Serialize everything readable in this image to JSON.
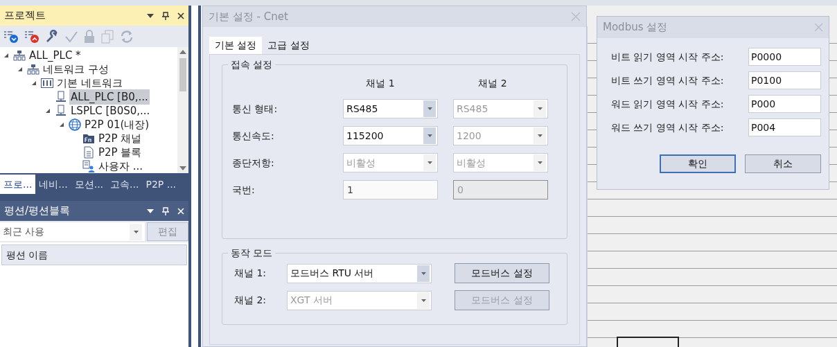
{
  "project_panel": {
    "title": "프로젝트",
    "tree": [
      {
        "label": "ALL_PLC *",
        "kind": "network",
        "expanded": true,
        "selected": false,
        "children": [
          {
            "label": "네트워크 구성",
            "kind": "network",
            "expanded": true,
            "selected": false,
            "children": [
              {
                "label": "기본 네트워크",
                "kind": "rack",
                "expanded": true,
                "selected": false,
                "children": [
                  {
                    "label": "ALL_PLC [B0,...",
                    "kind": "plc",
                    "expanded": false,
                    "selected": true
                  },
                  {
                    "label": "LSPLC [B0S0,...",
                    "kind": "plc",
                    "expanded": true,
                    "selected": false,
                    "children": [
                      {
                        "label": "P2P 01(내장)",
                        "kind": "globe",
                        "expanded": true,
                        "selected": false,
                        "children": [
                          {
                            "label": "P2P 채널",
                            "kind": "fn",
                            "expanded": false,
                            "selected": false
                          },
                          {
                            "label": "P2P 블록",
                            "kind": "doc",
                            "expanded": false,
                            "selected": false
                          },
                          {
                            "label": "사용자 ...",
                            "kind": "user",
                            "expanded": false,
                            "selected": false
                          }
                        ]
                      }
                    ]
                  }
                ]
              }
            ]
          }
        ]
      }
    ]
  },
  "bottom_tabs": [
    {
      "label": "프로...",
      "selected": true
    },
    {
      "label": "네비...",
      "selected": false
    },
    {
      "label": "모션...",
      "selected": false
    },
    {
      "label": "고속...",
      "selected": false
    },
    {
      "label": "P2P ...",
      "selected": false
    }
  ],
  "function_panel": {
    "title": "평션/평션블록",
    "filter": {
      "value": "최근 사용"
    },
    "edit_button": "편집",
    "column": "평션 이름"
  },
  "cnet_dialog": {
    "title": "기본 설정 - Cnet",
    "tabs": [
      {
        "label": "기본 설정",
        "selected": true
      },
      {
        "label": "고급 설정",
        "selected": false
      }
    ],
    "connection": {
      "title": "접속 설정",
      "columns": [
        "채널 1",
        "채널 2"
      ],
      "rows": [
        {
          "label": "통신 형태:",
          "cells": [
            {
              "kind": "combo",
              "value": "RS485",
              "disabled": false
            },
            {
              "kind": "combo",
              "value": "RS485",
              "disabled": true
            }
          ]
        },
        {
          "label": "통신속도:",
          "cells": [
            {
              "kind": "combo",
              "value": "115200",
              "disabled": false
            },
            {
              "kind": "combo",
              "value": "1200",
              "disabled": true
            }
          ]
        },
        {
          "label": "종단저항:",
          "cells": [
            {
              "kind": "combo",
              "value": "비활성",
              "disabled": true
            },
            {
              "kind": "combo",
              "value": "비활성",
              "disabled": true
            }
          ]
        },
        {
          "label": "국번:",
          "cells": [
            {
              "kind": "field",
              "value": "1",
              "disabled": false
            },
            {
              "kind": "field",
              "value": "0",
              "disabled": true
            }
          ]
        }
      ]
    },
    "mode": {
      "title": "동작 모드",
      "rows": [
        {
          "label": "채널 1:",
          "combo": {
            "value": "모드버스 RTU 서버",
            "disabled": false
          },
          "button": {
            "label": "모드버스 설정",
            "disabled": false
          }
        },
        {
          "label": "채널 2:",
          "combo": {
            "value": "XGT 서버",
            "disabled": true
          },
          "button": {
            "label": "모드버스 설정",
            "disabled": true
          }
        }
      ]
    }
  },
  "modbus_dialog": {
    "title": "Modbus 설정",
    "fields": [
      {
        "label": "비트 읽기 영역 시작 주소:",
        "value": "P0000"
      },
      {
        "label": "비트 쓰기 영역 시작 주소:",
        "value": "P0100"
      },
      {
        "label": "워드 읽기 영역 시작 주소:",
        "value": "P000"
      },
      {
        "label": "워드 쓰기 영역 시작 주소:",
        "value": "P004"
      }
    ],
    "buttons": [
      {
        "label": "확인",
        "focused": true
      },
      {
        "label": "취소",
        "focused": false
      }
    ]
  }
}
